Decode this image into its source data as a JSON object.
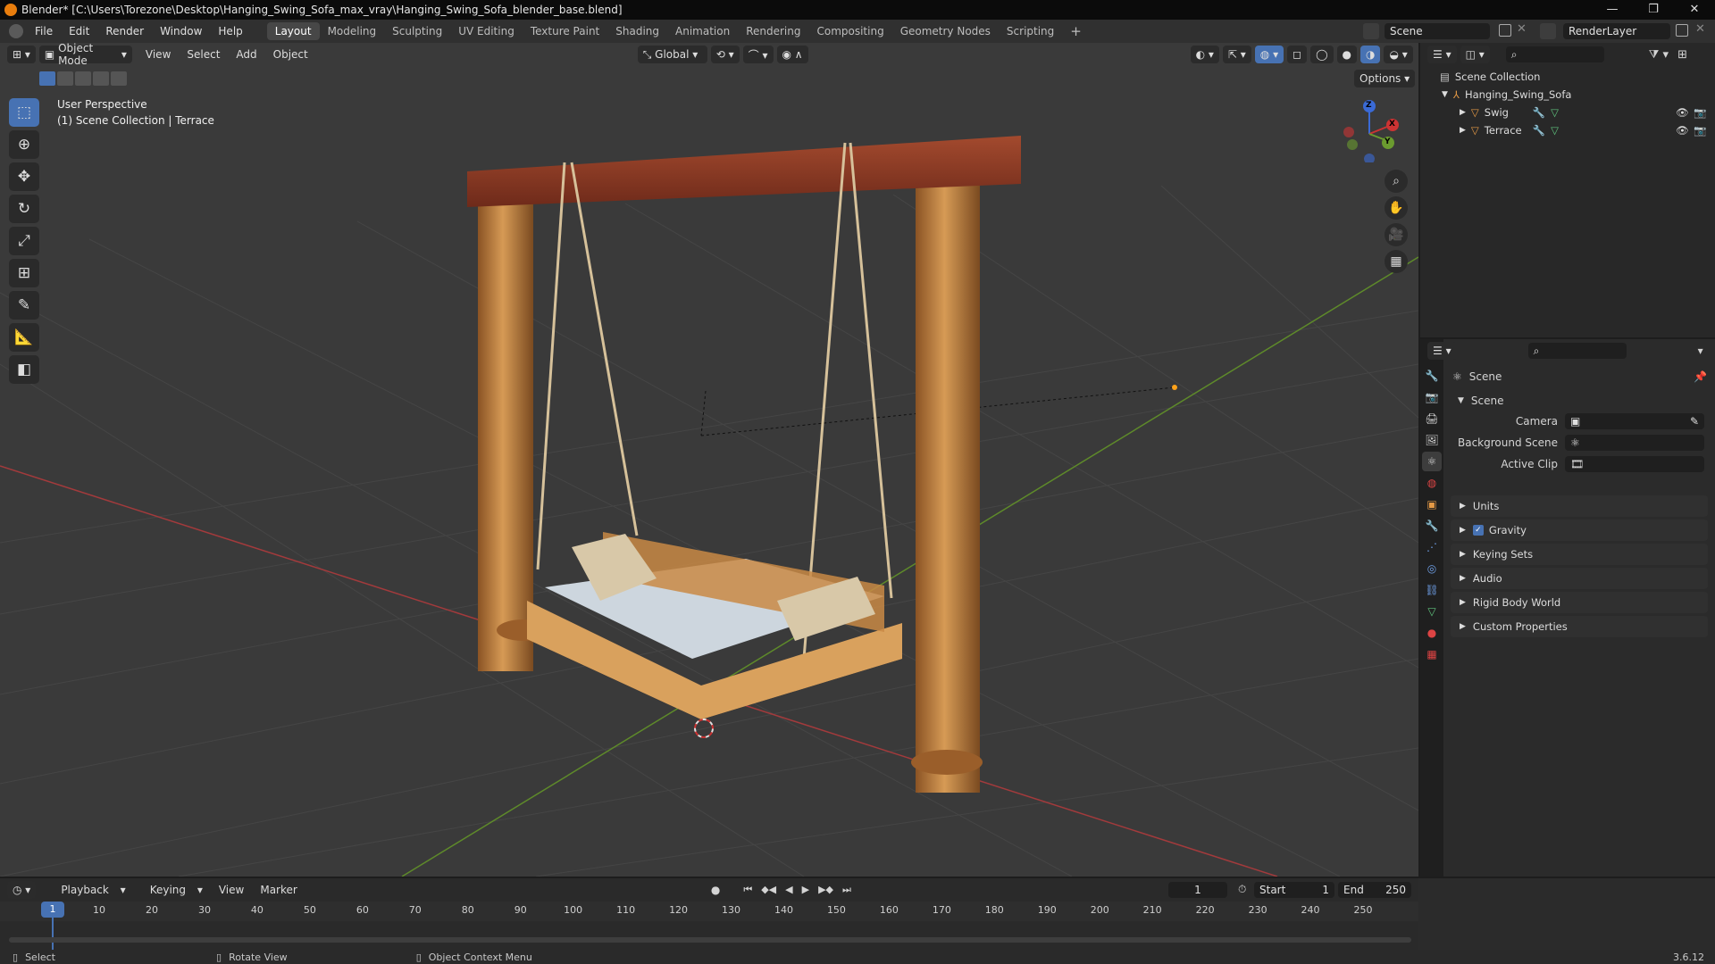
{
  "titlebar": {
    "title": "Blender* [C:\\Users\\Torezone\\Desktop\\Hanging_Swing_Sofa_max_vray\\Hanging_Swing_Sofa_blender_base.blend]",
    "minimize": "—",
    "maximize": "❐",
    "close": "✕"
  },
  "menu": {
    "items": [
      "File",
      "Edit",
      "Render",
      "Window",
      "Help"
    ]
  },
  "workspaces": {
    "tabs": [
      "Layout",
      "Modeling",
      "Sculpting",
      "UV Editing",
      "Texture Paint",
      "Shading",
      "Animation",
      "Rendering",
      "Compositing",
      "Geometry Nodes",
      "Scripting"
    ],
    "active": "Layout",
    "add": "+"
  },
  "scene_field": "Scene",
  "renderlayer_field": "RenderLayer",
  "viewport": {
    "mode": "Object Mode",
    "menus": [
      "View",
      "Select",
      "Add",
      "Object"
    ],
    "orientation": "Global",
    "options": "Options",
    "overlay_line1": "User Perspective",
    "overlay_line2": "(1) Scene Collection | Terrace",
    "gizmo": {
      "z": "Z",
      "y": "Y",
      "x": "X"
    }
  },
  "outliner": {
    "root": "Scene Collection",
    "collection": "Hanging_Swing_Sofa",
    "objects": [
      "Swig",
      "Terrace"
    ]
  },
  "properties": {
    "header": "Scene",
    "section": "Scene",
    "fields": [
      {
        "label": "Camera"
      },
      {
        "label": "Background Scene"
      },
      {
        "label": "Active Clip"
      }
    ],
    "panels": [
      "Units",
      "Gravity",
      "Keying Sets",
      "Audio",
      "Rigid Body World",
      "Custom Properties"
    ],
    "gravity_checked": true
  },
  "timeline": {
    "menus": [
      "Playback",
      "Keying",
      "View",
      "Marker"
    ],
    "current_frame": "1",
    "start_label": "Start",
    "start": "1",
    "end_label": "End",
    "end": "250",
    "ticks": [
      "1",
      "10",
      "20",
      "30",
      "40",
      "50",
      "60",
      "70",
      "80",
      "90",
      "100",
      "110",
      "120",
      "130",
      "140",
      "150",
      "160",
      "170",
      "180",
      "190",
      "200",
      "210",
      "220",
      "230",
      "240",
      "250"
    ]
  },
  "statusbar": {
    "select": "Select",
    "rotate": "Rotate View",
    "context": "Object Context Menu",
    "version": "3.6.12"
  },
  "colors": {
    "accent": "#4772b3",
    "x_axis": "#c0393b",
    "y_axis": "#6a9b2f",
    "wood": "#c98a45",
    "beam": "#8a3a24",
    "cushion": "#cfd8e0"
  }
}
